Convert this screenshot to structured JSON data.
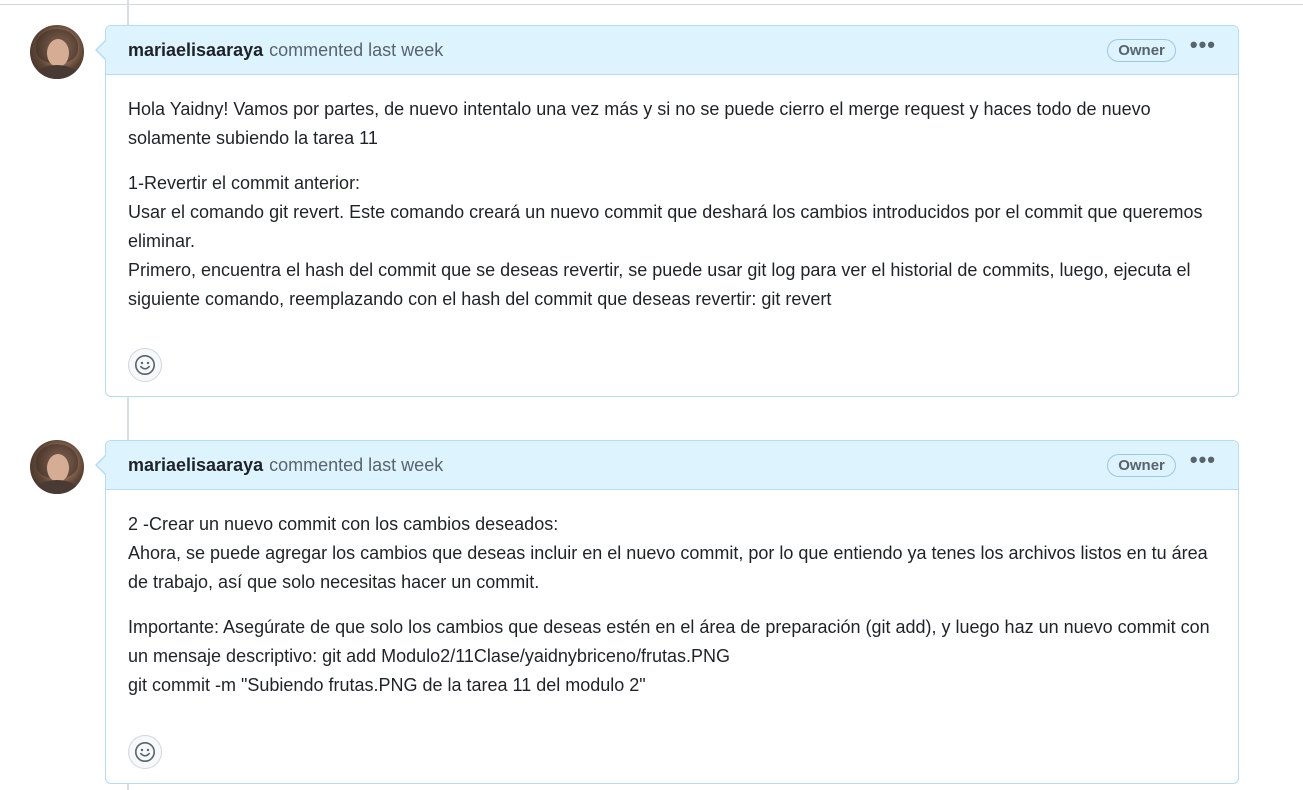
{
  "comments": [
    {
      "author": "mariaelisaaraya",
      "meta": "commented last week",
      "badge": "Owner",
      "more_icon": "kebab-horizontal-icon",
      "paragraphs": [
        {
          "lines": [
            "Hola Yaidny! Vamos por partes, de nuevo intentalo una vez más y si no se puede cierro el merge request y haces todo de nuevo solamente subiendo la tarea 11"
          ]
        },
        {
          "lines": [
            "1-Revertir el commit anterior:",
            "Usar el comando git revert. Este comando creará un nuevo commit que deshará los cambios introducidos por el commit que queremos eliminar.",
            "Primero, encuentra el hash del commit que se deseas revertir, se puede usar git log para ver el historial de commits, luego, ejecuta el siguiente comando, reemplazando con el hash del commit que deseas revertir: git revert"
          ]
        }
      ],
      "reaction_icon": "smiley-icon"
    },
    {
      "author": "mariaelisaaraya",
      "meta": "commented last week",
      "badge": "Owner",
      "more_icon": "kebab-horizontal-icon",
      "paragraphs": [
        {
          "lines": [
            "2 -Crear un nuevo commit con los cambios deseados:",
            "Ahora, se puede agregar los cambios que deseas incluir en el nuevo commit, por lo que entiendo ya tenes los archivos listos en tu área de trabajo, así que solo necesitas hacer un commit."
          ]
        },
        {
          "lines": [
            "Importante: Asegúrate de que solo los cambios que deseas estén en el área de preparación (git add), y luego haz un nuevo commit con un mensaje descriptivo: git add Modulo2/11Clase/yaidnybriceno/frutas.PNG",
            "git commit -m \"Subiendo frutas.PNG de la tarea 11 del modulo 2\""
          ]
        }
      ],
      "reaction_icon": "smiley-icon"
    }
  ],
  "colors": {
    "header_bg": "#ddf4ff",
    "border": "#b6dbf4",
    "text": "#1f2328",
    "muted": "#59636e"
  }
}
